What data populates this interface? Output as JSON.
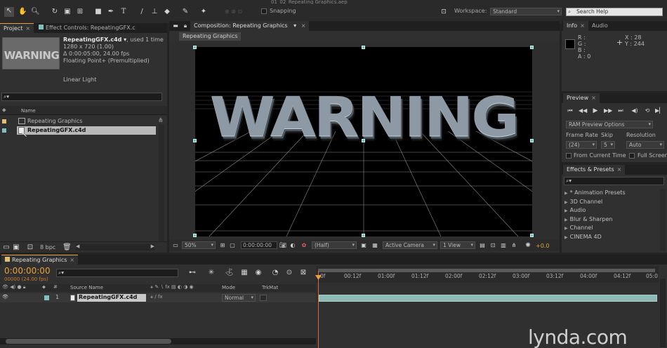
{
  "window": {
    "title": "01_02_Repeating Graphics.aep"
  },
  "toolbar": {
    "snapping_label": "Snapping",
    "workspace_label": "Workspace:",
    "workspace_value": "Standard",
    "search_placeholder": "Search Help"
  },
  "project_panel": {
    "tab_project": "Project",
    "tab_effect_controls": "Effect Controls: RepeatingGFX.c",
    "thumbnail_text": "WARNING",
    "footage_name": "RepeatingGFX.c4d ▾",
    "footage_used": ", used 1 time",
    "footage_dims": "1280 x 720 (1.00)",
    "footage_duration": "Δ 0:00:05:00, 24.00 fps",
    "footage_color": "Floating Point+ (Premultiplied)",
    "footage_light": "Linear Light",
    "search_placeholder": "",
    "column_name": "Name",
    "items": [
      {
        "name": "Repeating Graphics",
        "label_color": "#e0c070",
        "selected": false
      },
      {
        "name": "RepeatingGFX.c4d",
        "label_color": "#7fc0c0",
        "selected": true
      }
    ],
    "bpc_label": "8 bpc"
  },
  "composition_panel": {
    "tab_label": "Composition: Repeating Graphics",
    "subtab_label": "Repeating Graphics",
    "canvas_text": "WARNING",
    "zoom_value": "50%",
    "timecode": "0:00:00:00",
    "resolution_value": "(Half)",
    "camera_value": "Active Camera",
    "view_value": "1 View",
    "exposure_value": "+0.0"
  },
  "info_panel": {
    "tab_info": "Info",
    "tab_audio": "Audio",
    "r_label": "R :",
    "g_label": "G :",
    "b_label": "B :",
    "a_label": "A : 0",
    "x_label": "X : 28",
    "y_label": "Y : 244"
  },
  "preview_panel": {
    "tab_label": "Preview",
    "options_value": "RAM Preview Options",
    "frame_rate_label": "Frame Rate",
    "skip_label": "Skip",
    "resolution_label": "Resolution",
    "frame_rate_value": "(24)",
    "skip_value": "5",
    "resolution_value": "Auto",
    "from_current_label": "From Current Time",
    "full_screen_label": "Full Screen"
  },
  "effects_panel": {
    "tab_label": "Effects & Presets",
    "search_placeholder": "",
    "items": [
      "* Animation Presets",
      "3D Channel",
      "Audio",
      "Blur & Sharpen",
      "Channel",
      "CINEMA 4D"
    ]
  },
  "timeline": {
    "tab_label": "Repeating Graphics",
    "timecode": "0:00:00:00",
    "timecode_sub": "00000 (24.00 fps)",
    "search_placeholder": "",
    "col_source_name": "Source Name",
    "col_mode": "Mode",
    "col_trkmat": "TrkMat",
    "layer_index": "1",
    "layer_name": "RepeatingGFX.c4d",
    "layer_mode": "Normal",
    "ruler_labels": [
      "0f",
      "00:12f",
      "01:00f",
      "01:12f",
      "02:00f",
      "02:12f",
      "03:00f",
      "03:12f",
      "04:00f",
      "04:12f",
      "05:0"
    ]
  },
  "watermark": "lynda.com",
  "colors": {
    "accent_orange": "#e8a23a",
    "handle_teal": "#5fc6c2",
    "layer_bar": "#8fb9b5",
    "playhead": "#d06a3a"
  }
}
